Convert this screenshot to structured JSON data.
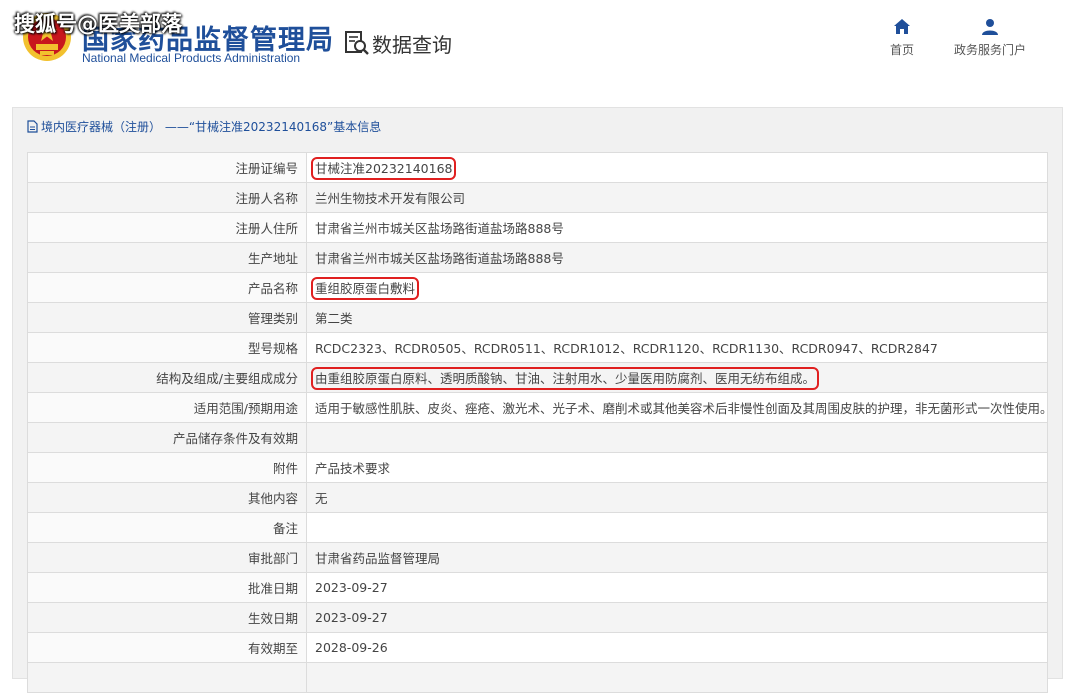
{
  "watermark": "搜狐号@医美部落",
  "logo": {
    "cn": "国家药品监督管理局",
    "en": "National Medical Products Administration"
  },
  "header": {
    "section_title": "数据查询",
    "nav": [
      {
        "label": "首页",
        "icon": "home-icon"
      },
      {
        "label": "政务服务门户",
        "icon": "user-icon"
      }
    ]
  },
  "panel": {
    "title": "境内医疗器械（注册） ——“甘械注准20232140168”基本信息",
    "rows": [
      {
        "label": "注册证编号",
        "value": "甘械注准20232140168",
        "highlighted": true
      },
      {
        "label": "注册人名称",
        "value": "兰州生物技术开发有限公司",
        "highlighted": false
      },
      {
        "label": "注册人住所",
        "value": "甘肃省兰州市城关区盐场路街道盐场路888号",
        "highlighted": false
      },
      {
        "label": "生产地址",
        "value": "甘肃省兰州市城关区盐场路街道盐场路888号",
        "highlighted": false
      },
      {
        "label": "产品名称",
        "value": "重组胶原蛋白敷料",
        "highlighted": true
      },
      {
        "label": "管理类别",
        "value": "第二类",
        "highlighted": false
      },
      {
        "label": "型号规格",
        "value": "RCDC2323、RCDR0505、RCDR0511、RCDR1012、RCDR1120、RCDR1130、RCDR0947、RCDR2847",
        "highlighted": false
      },
      {
        "label": "结构及组成/主要组成成分",
        "value": "由重组胶原蛋白原料、透明质酸钠、甘油、注射用水、少量医用防腐剂、医用无纺布组成。",
        "highlighted": true
      },
      {
        "label": "适用范围/预期用途",
        "value": "适用于敏感性肌肤、皮炎、痤疮、激光术、光子术、磨削术或其他美容术后非慢性创面及其周围皮肤的护理，非无菌形式一次性使用。",
        "highlighted": false
      },
      {
        "label": "产品储存条件及有效期",
        "value": "",
        "highlighted": false
      },
      {
        "label": "附件",
        "value": "产品技术要求",
        "highlighted": false
      },
      {
        "label": "其他内容",
        "value": "无",
        "highlighted": false
      },
      {
        "label": "备注",
        "value": "",
        "highlighted": false
      },
      {
        "label": "审批部门",
        "value": "甘肃省药品监督管理局",
        "highlighted": false
      },
      {
        "label": "批准日期",
        "value": "2023-09-27",
        "highlighted": false
      },
      {
        "label": "生效日期",
        "value": "2023-09-27",
        "highlighted": false
      },
      {
        "label": "有效期至",
        "value": "2028-09-26",
        "highlighted": false
      },
      {
        "label": "",
        "value": "",
        "highlighted": false
      }
    ]
  },
  "colors": {
    "brand": "#1f4f9a",
    "highlight": "#e02020",
    "emblem_red": "#c8161d",
    "emblem_gold": "#f2c12e"
  }
}
